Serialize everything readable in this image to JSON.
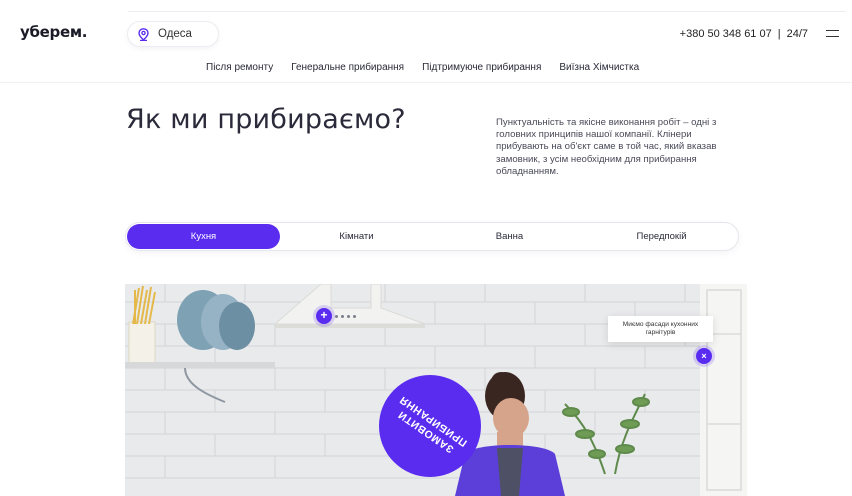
{
  "brand": {
    "logo": "уберем."
  },
  "header": {
    "city": "Одеса",
    "phone": "+380 50 348 61 07",
    "hours_sep": "|",
    "hours": "24/7"
  },
  "nav": {
    "items": [
      {
        "label": "Після ремонту"
      },
      {
        "label": "Генеральне прибирання"
      },
      {
        "label": "Підтримуюче прибирання"
      },
      {
        "label": "Виїзна Хімчистка"
      }
    ]
  },
  "hero": {
    "title": "Як ми прибираємо?",
    "description": "Пунктуальність та якісне виконання робіт – одні з головних принципів нашої компанії. Клінери прибувають на об'єкт саме в той час, який вказав замовник, з усім необхідним для прибирання обладнанням."
  },
  "tabs": {
    "items": [
      {
        "label": "Кухня",
        "active": true
      },
      {
        "label": "Кімнати",
        "active": false
      },
      {
        "label": "Ванна",
        "active": false
      },
      {
        "label": "Передпокій",
        "active": false
      }
    ]
  },
  "photo": {
    "hotspot_plus": "+",
    "tooltip": "Миємо фасади кухонних гарнітурів",
    "hotspot_close": "×"
  },
  "order_button": {
    "label": "ЗАМОВИТИ ПРИБИРАННЯ"
  },
  "colors": {
    "accent": "#5a2cf0",
    "text": "#1f1f2e"
  }
}
